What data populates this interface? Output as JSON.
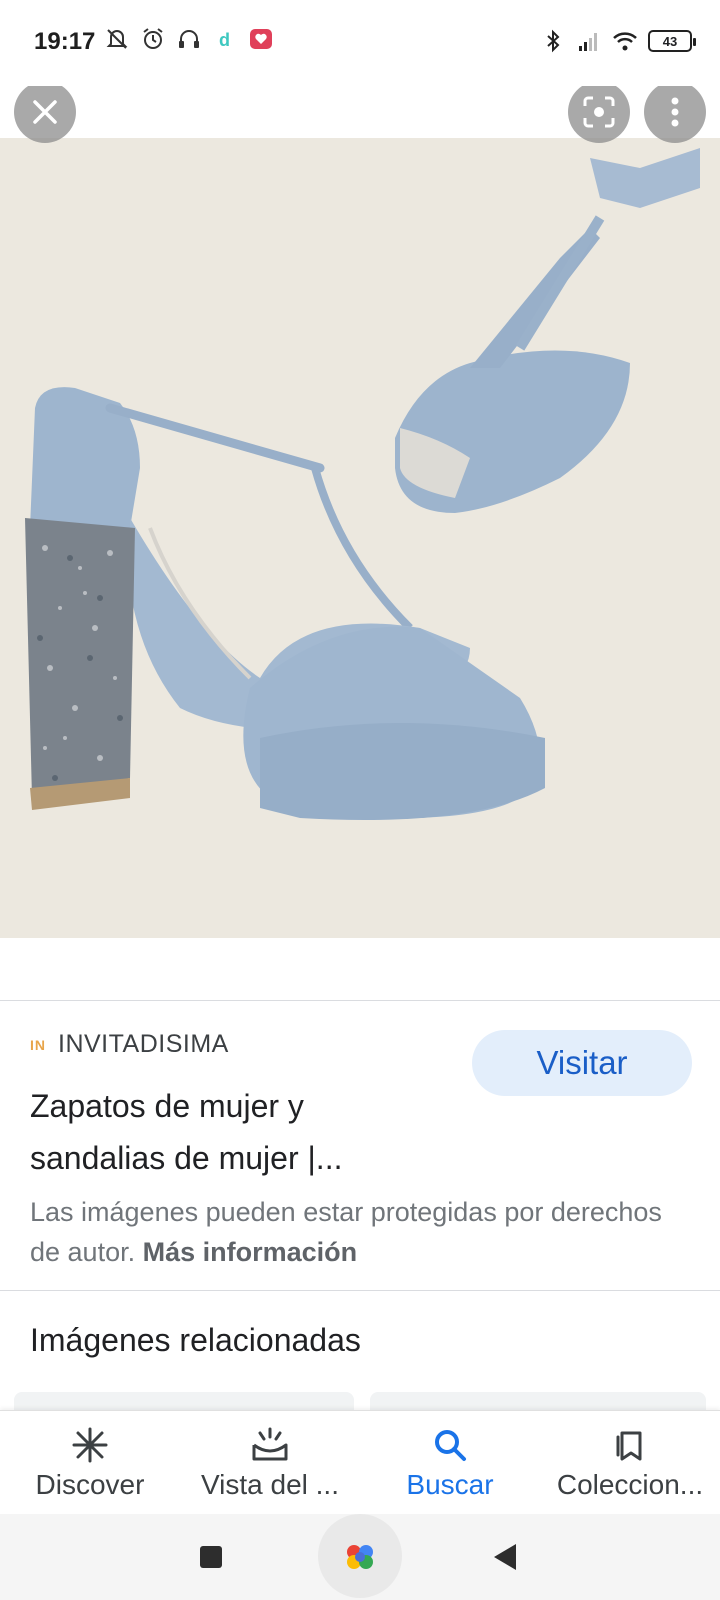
{
  "status_bar": {
    "time": "19:17",
    "left_icons": [
      "silent-alarm-icon",
      "alarm-clock-icon",
      "headphones-icon",
      "d-app-icon",
      "heart-app-icon"
    ],
    "right_icons": [
      "bluetooth-icon",
      "signal-icon",
      "wifi-icon"
    ],
    "battery": "43"
  },
  "viewer": {
    "close_icon": "close-icon",
    "lens_icon": "lens-icon",
    "more_icon": "more-vertical-icon"
  },
  "result": {
    "source_logo": "IN",
    "source_name": "INVITADISIMA",
    "visit_label": "Visitar",
    "title_line1": "Zapatos de mujer y",
    "title_line2": "sandalias de mujer |...",
    "copyright_text": "Las imágenes pueden estar protegidas por derechos de autor. ",
    "more_info_label": "Más información"
  },
  "related": {
    "title": "Imágenes relacionadas"
  },
  "bottom_nav": {
    "items": [
      {
        "label": "Discover",
        "icon": "discover-icon"
      },
      {
        "label": "Vista del ...",
        "icon": "updates-icon"
      },
      {
        "label": "Buscar",
        "icon": "search-icon"
      },
      {
        "label": "Coleccion...",
        "icon": "collections-icon"
      }
    ],
    "active_index": 2
  },
  "colors": {
    "accent": "#1a73e8",
    "visit_bg": "#e3eefb",
    "shoe_blue": "#9fb6cf"
  }
}
